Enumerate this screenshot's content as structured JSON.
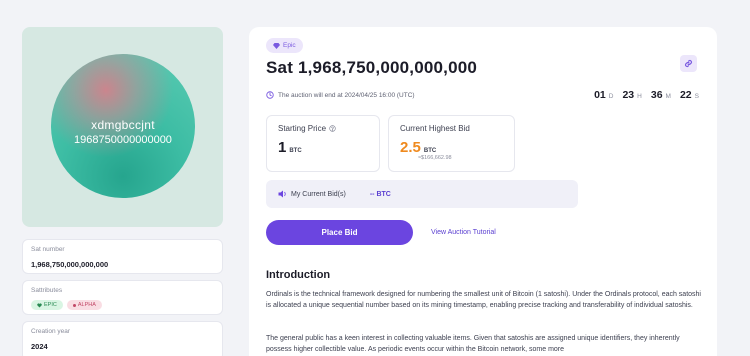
{
  "art": {
    "name": "xdmgbccjnt",
    "number": "1968750000000000"
  },
  "sat_number": {
    "label": "Sat number",
    "value": "1,968,750,000,000,000"
  },
  "sattributes": {
    "label": "Sattributes",
    "tags": [
      "EPIC",
      "ALPHA"
    ]
  },
  "creation_year": {
    "label": "Creation year",
    "value": "2024"
  },
  "badge": "Epic",
  "title": "Sat 1,968,750,000,000,000",
  "auction_text": "The auction will end at 2024/04/25 16:00 (UTC)",
  "countdown": {
    "d": "01",
    "d_unit": "D",
    "h": "23",
    "h_unit": "H",
    "m": "36",
    "m_unit": "M",
    "s": "22",
    "s_unit": "S"
  },
  "starting_price": {
    "label": "Starting Price",
    "value": "1",
    "unit": "BTC"
  },
  "highest_bid": {
    "label": "Current Highest Bid",
    "value": "2.5",
    "unit": "BTC",
    "usd": "≈$166,662.98"
  },
  "my_bid": {
    "label": "My Current Bid(s)",
    "value": "-- BTC"
  },
  "place_bid": "Place Bid",
  "tutorial_link": "View Auction Tutorial",
  "intro": {
    "heading": "Introduction",
    "p1": "Ordinals is the technical framework designed for numbering the smallest unit of Bitcoin (1 satoshi). Under the Ordinals protocol, each satoshi is allocated a unique sequential number based on its mining timestamp, enabling precise tracking and transferability of individual satoshis.",
    "p2": "The general public has a keen interest in collecting valuable items. Given that satoshis are assigned unique identifiers, they inherently possess higher collectible value. As periodic events occur within the Bitcoin network, some more"
  },
  "colors": {
    "accent": "#6b45e0",
    "orange": "#ef8a1f",
    "epic_tag": "#2a8a53",
    "alpha_tag": "#c24867"
  }
}
